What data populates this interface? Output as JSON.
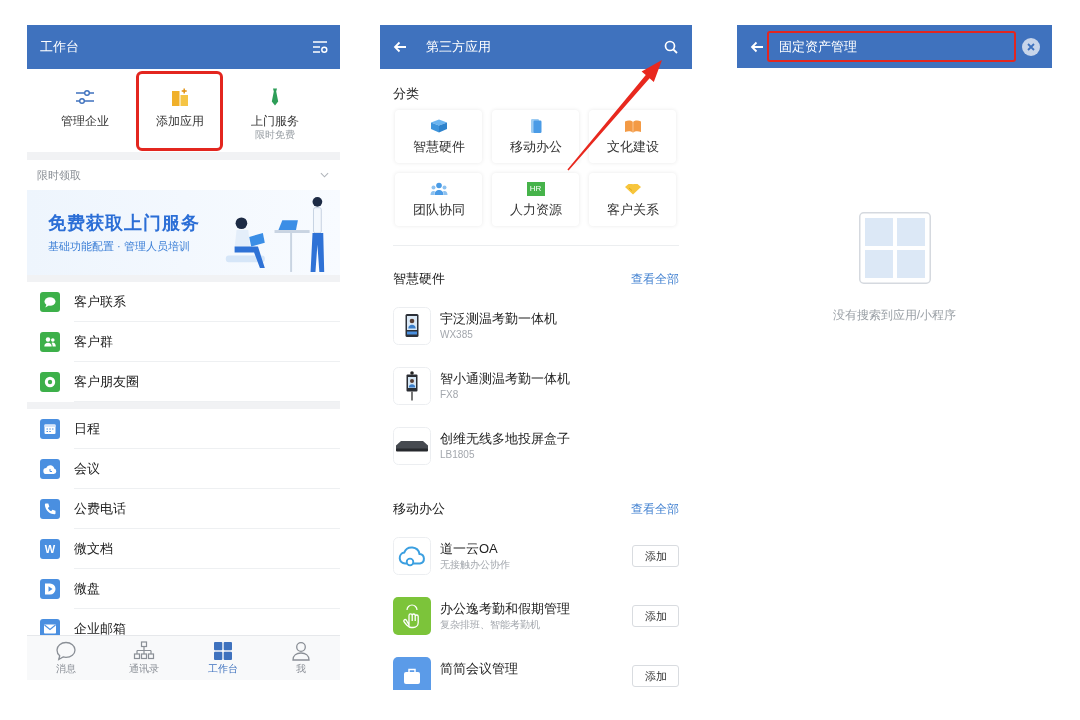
{
  "workbench": {
    "title": "工作台",
    "shortcuts": [
      {
        "label": "管理企业",
        "highlighted": false
      },
      {
        "label": "添加应用",
        "highlighted": true
      },
      {
        "label": "上门服务",
        "sublabel": "限时免费",
        "highlighted": false
      }
    ],
    "promo": {
      "section_title": "限时领取",
      "headline": "免费获取上门服务",
      "subtitle": "基础功能配置 · 管理人员培训"
    },
    "app_groups": [
      [
        {
          "label": "客户联系"
        },
        {
          "label": "客户群"
        },
        {
          "label": "客户朋友圈"
        }
      ],
      [
        {
          "label": "日程"
        },
        {
          "label": "会议"
        },
        {
          "label": "公费电话"
        },
        {
          "label": "微文档",
          "icon_text": "W"
        },
        {
          "label": "微盘"
        },
        {
          "label": "企业邮箱"
        }
      ]
    ],
    "tabs": [
      {
        "label": "消息",
        "selected": false
      },
      {
        "label": "通讯录",
        "selected": false
      },
      {
        "label": "工作台",
        "selected": true
      },
      {
        "label": "我",
        "selected": false
      }
    ]
  },
  "third_party_apps": {
    "title": "第三方应用",
    "categories_title": "分类",
    "categories": [
      {
        "label": "智慧硬件"
      },
      {
        "label": "移动办公"
      },
      {
        "label": "文化建设"
      },
      {
        "label": "团队协同"
      },
      {
        "label": "人力资源",
        "icon_text": "HR"
      },
      {
        "label": "客户关系"
      }
    ],
    "sections": [
      {
        "title": "智慧硬件",
        "link": "查看全部",
        "apps": [
          {
            "name": "宇泛测温考勤一体机",
            "subtitle": "WX385"
          },
          {
            "name": "智小通测温考勤一体机",
            "subtitle": "FX8"
          },
          {
            "name": "创维无线多地投屏盒子",
            "subtitle": "LB1805"
          }
        ]
      },
      {
        "title": "移动办公",
        "link": "查看全部",
        "apps": [
          {
            "name": "道一云OA",
            "subtitle": "无接触办公协作",
            "button": "添加"
          },
          {
            "name": "办公逸考勤和假期管理",
            "subtitle": "复杂排班、智能考勤机",
            "button": "添加"
          },
          {
            "name": "简简会议管理",
            "button": "添加"
          }
        ]
      }
    ]
  },
  "search": {
    "query": "固定资产管理",
    "highlighted": true,
    "empty_message": "没有搜索到应用/小程序"
  }
}
